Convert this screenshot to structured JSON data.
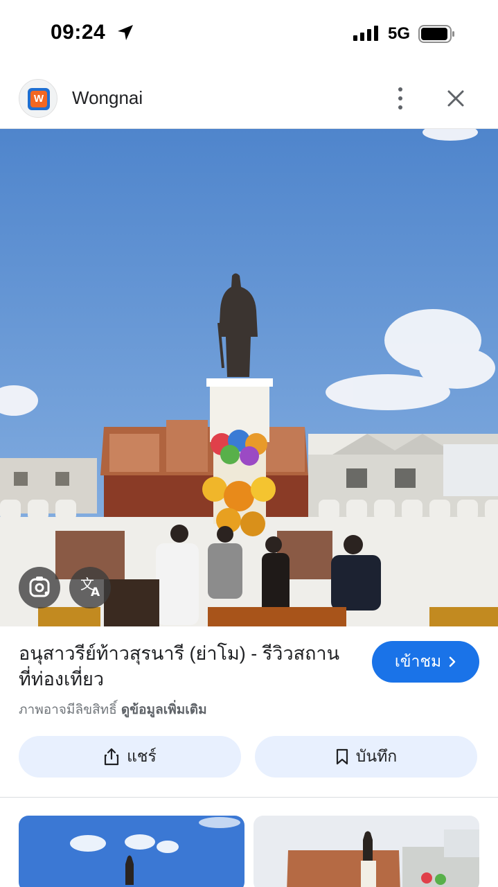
{
  "status_bar": {
    "time": "09:24",
    "network": "5G"
  },
  "header": {
    "app_name": "Wongnai",
    "logo_letter": "W"
  },
  "image": {
    "description_icon": "monument-photo"
  },
  "result": {
    "title": "อนุสาวรีย์ท้าวสุรนารี (ย่าโม) - รีวิวสถานที่ท่องเที่ยว",
    "visit_label": "เข้าชม",
    "copyright_text": "ภาพอาจมีลิขสิทธิ์",
    "more_info_label": "ดูข้อมูลเพิ่มเติม"
  },
  "actions": {
    "share_label": "แชร์",
    "save_label": "บันทึก"
  },
  "colors": {
    "accent": "#1a73e8",
    "button_bg": "#e8f0fe",
    "sky": "#5b8dd0"
  }
}
